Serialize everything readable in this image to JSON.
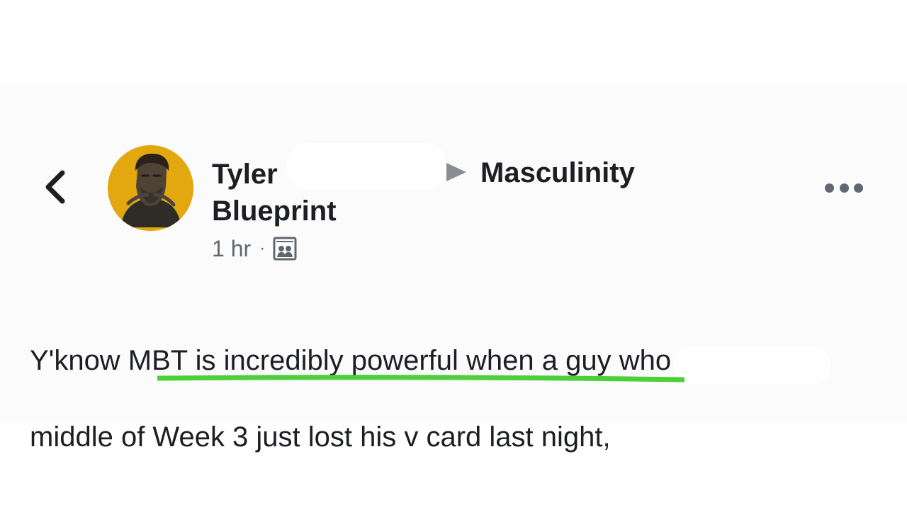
{
  "post": {
    "author_line1": "Tyler",
    "author_line2": "Blueprint",
    "group": "Masculinity",
    "time": "1 hr",
    "separator": "·",
    "audience_icon": "group-audience-icon",
    "text_line1": "Y'know MBT is incredibly powerful when a guy who is in the",
    "text_line2": "middle of Week 3 just lost his v card last night,"
  },
  "nav": {
    "back_icon": "chevron-left-icon",
    "more_icon": "more-options-icon"
  },
  "annotation": {
    "underlined_text": "Week 3 just lost his v card last night,",
    "color": "#4ccf38"
  },
  "colors": {
    "avatar_background": "#e3a80f",
    "primary_text": "#1c1e21",
    "secondary_text": "#606770",
    "arrow": "#8a8d91"
  }
}
